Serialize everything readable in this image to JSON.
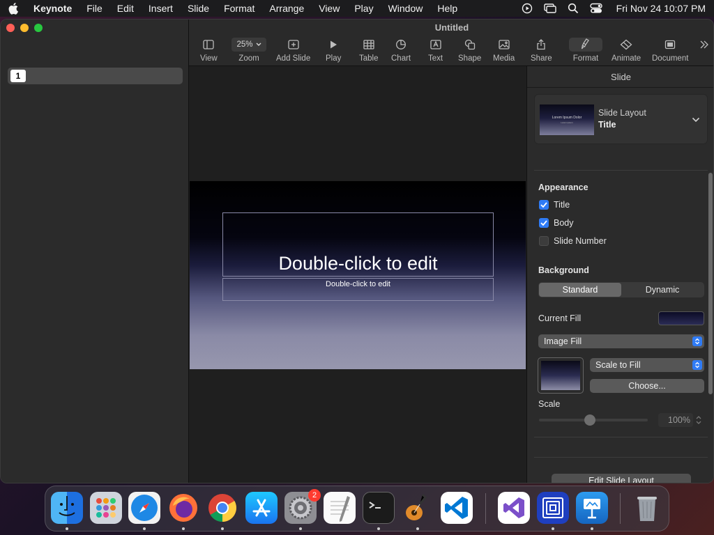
{
  "menubar": {
    "app_name": "Keynote",
    "items": [
      "File",
      "Edit",
      "Insert",
      "Slide",
      "Format",
      "Arrange",
      "View",
      "Play",
      "Window",
      "Help"
    ],
    "clock": "Fri Nov 24  10:07 PM"
  },
  "window": {
    "title": "Untitled"
  },
  "toolbar": {
    "view": "View",
    "zoom_value": "25%",
    "zoom": "Zoom",
    "add_slide": "Add Slide",
    "play": "Play",
    "table": "Table",
    "chart": "Chart",
    "text": "Text",
    "shape": "Shape",
    "media": "Media",
    "share": "Share",
    "format": "Format",
    "animate": "Animate",
    "document": "Document"
  },
  "navigator": {
    "slides": [
      {
        "number": "1"
      }
    ]
  },
  "slide": {
    "title_placeholder": "Double-click to edit",
    "body_placeholder": "Double-click to edit"
  },
  "inspector": {
    "tab": "Slide",
    "layout_label": "Slide Layout",
    "layout_value": "Title",
    "layout_thumb_title": "Lorem Ipsum Dolor",
    "layout_thumb_sub": "Lorem ipsum",
    "appearance_heading": "Appearance",
    "appearance": [
      {
        "label": "Title",
        "checked": true
      },
      {
        "label": "Body",
        "checked": true
      },
      {
        "label": "Slide Number",
        "checked": false
      }
    ],
    "background_heading": "Background",
    "bg_modes": [
      "Standard",
      "Dynamic"
    ],
    "bg_selected": "Standard",
    "current_fill_label": "Current Fill",
    "fill_type": "Image Fill",
    "scale_mode": "Scale to Fill",
    "choose": "Choose...",
    "scale_label": "Scale",
    "scale_value": "100%",
    "edit_layout": "Edit Slide Layout"
  },
  "dock": {
    "apps": [
      "Finder",
      "Launchpad",
      "Safari",
      "Firefox",
      "Chrome",
      "App Store",
      "System Settings",
      "TextEdit",
      "Terminal",
      "GarageBand",
      "Visual Studio Code",
      "Visual Studio",
      "Screen Sharing",
      "Keynote",
      "Trash"
    ],
    "settings_badge": "2"
  },
  "colors": {
    "accent": "#2f7bf5",
    "close": "#ff5f57",
    "minimize": "#febc2e",
    "zoom": "#28c840"
  }
}
